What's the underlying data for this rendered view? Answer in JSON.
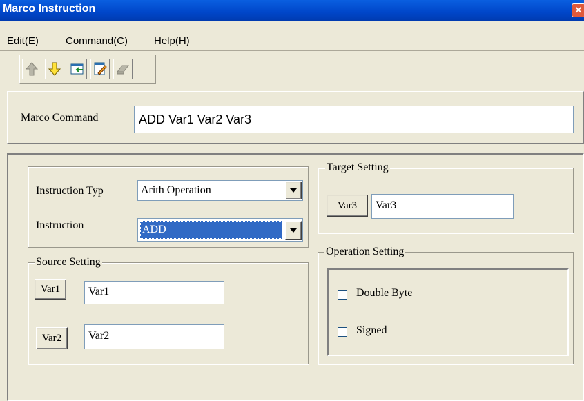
{
  "window": {
    "title": "Marco Instruction",
    "close_glyph": "✕"
  },
  "menu": [
    {
      "label": "Edit(E)"
    },
    {
      "label": "Command(C)"
    },
    {
      "label": "Help(H)"
    }
  ],
  "toolbar": {
    "buttons": [
      {
        "icon": "arrow-up-icon",
        "enabled": false
      },
      {
        "icon": "arrow-down-icon",
        "enabled": true
      },
      {
        "icon": "insert-icon",
        "enabled": true
      },
      {
        "icon": "edit-icon",
        "enabled": true
      },
      {
        "icon": "eraser-icon",
        "enabled": false
      }
    ]
  },
  "command": {
    "label": "Marco Command",
    "value": "ADD Var1 Var2 Var3"
  },
  "instruction": {
    "type_label": "Instruction Typ",
    "type_value": "Arith Operation",
    "instr_label": "Instruction",
    "instr_value": "ADD"
  },
  "source": {
    "legend": "Source Setting",
    "var1_button": "Var1",
    "var1_value": "Var1",
    "var2_button": "Var2",
    "var2_value": "Var2"
  },
  "target": {
    "legend": "Target Setting",
    "var3_button": "Var3",
    "var3_value": "Var3"
  },
  "operation": {
    "legend": "Operation Setting",
    "double_byte": {
      "label": "Double Byte",
      "checked": false
    },
    "signed": {
      "label": "Signed",
      "checked": false
    }
  },
  "colors": {
    "titlebar": "#0046c9",
    "selection": "#316ac5",
    "face": "#ece9d8"
  }
}
